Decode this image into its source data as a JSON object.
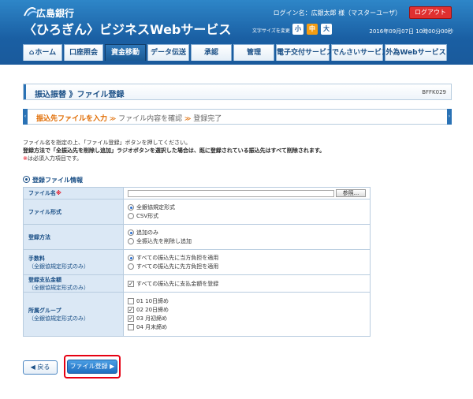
{
  "header": {
    "bank_name": "広島銀行",
    "service_name": "〈ひろぎん〉ビジネスWebサービス",
    "login_name": "ログイン名：広銀太郎 様（マスターユーザ）",
    "logout_label": "ログアウト",
    "font_size_label": "文字サイズを変更",
    "font_size_small": "小",
    "font_size_medium": "中",
    "font_size_large": "大",
    "datetime": "2016年09月07日 10時00分00秒"
  },
  "nav": {
    "home": "ホーム",
    "account": "口座照会",
    "transfer": "資金移動",
    "data": "データ伝送",
    "approval": "承認",
    "management": "管理",
    "edelivery": "電子交付サービス",
    "densai": "でんさいサービス",
    "forex": "外為Webサービス"
  },
  "page": {
    "title": "振込振替 》ファイル登録",
    "screen_id": "BFFK029"
  },
  "steps": {
    "current": "振込先ファイルを入力",
    "confirm": "ファイル内容を確認",
    "complete": "登録完了",
    "separator": "≫"
  },
  "instructions": {
    "line1": "ファイル名を指定の上、「ファイル登録」ボタンを押してください。",
    "line2": "登録方法で「全振込先を削除し追加」ラジオボタンを選択した場合は、既に登録されている振込先はすべて削除されます。",
    "req_mark": "※",
    "line3": "は必須入力項目です。"
  },
  "section": {
    "heading": "登録ファイル情報"
  },
  "form": {
    "file_name_label": "ファイル名",
    "required_mark": "※",
    "browse_label": "参照...",
    "file_format_label": "ファイル形式",
    "format_zengin": "全銀協規定形式",
    "format_csv": "CSV形式",
    "method_label": "登録方法",
    "method_add": "追加のみ",
    "method_replace": "全振込先を削除し追加",
    "fee_label": "手数料",
    "fee_sub": "（全銀協規定形式のみ）",
    "fee_ours": "すべての振込先に当方負担を適用",
    "fee_theirs": "すべての振込先に先方負担を適用",
    "amount_label": "登録支払金額",
    "amount_sub": "（全銀協規定形式のみ）",
    "amount_option": "すべての振込先に支払金額を登録",
    "group_label": "所属グループ",
    "group_sub": "（全銀協規定形式のみ）",
    "groups": [
      {
        "label": "01 10日締め",
        "checked": false
      },
      {
        "label": "02 20日締め",
        "checked": true
      },
      {
        "label": "03 月初締め",
        "checked": true
      },
      {
        "label": "04 月末締め",
        "checked": false
      }
    ]
  },
  "buttons": {
    "back": "◀ 戻る",
    "submit": "ファイル登録 ▶"
  }
}
